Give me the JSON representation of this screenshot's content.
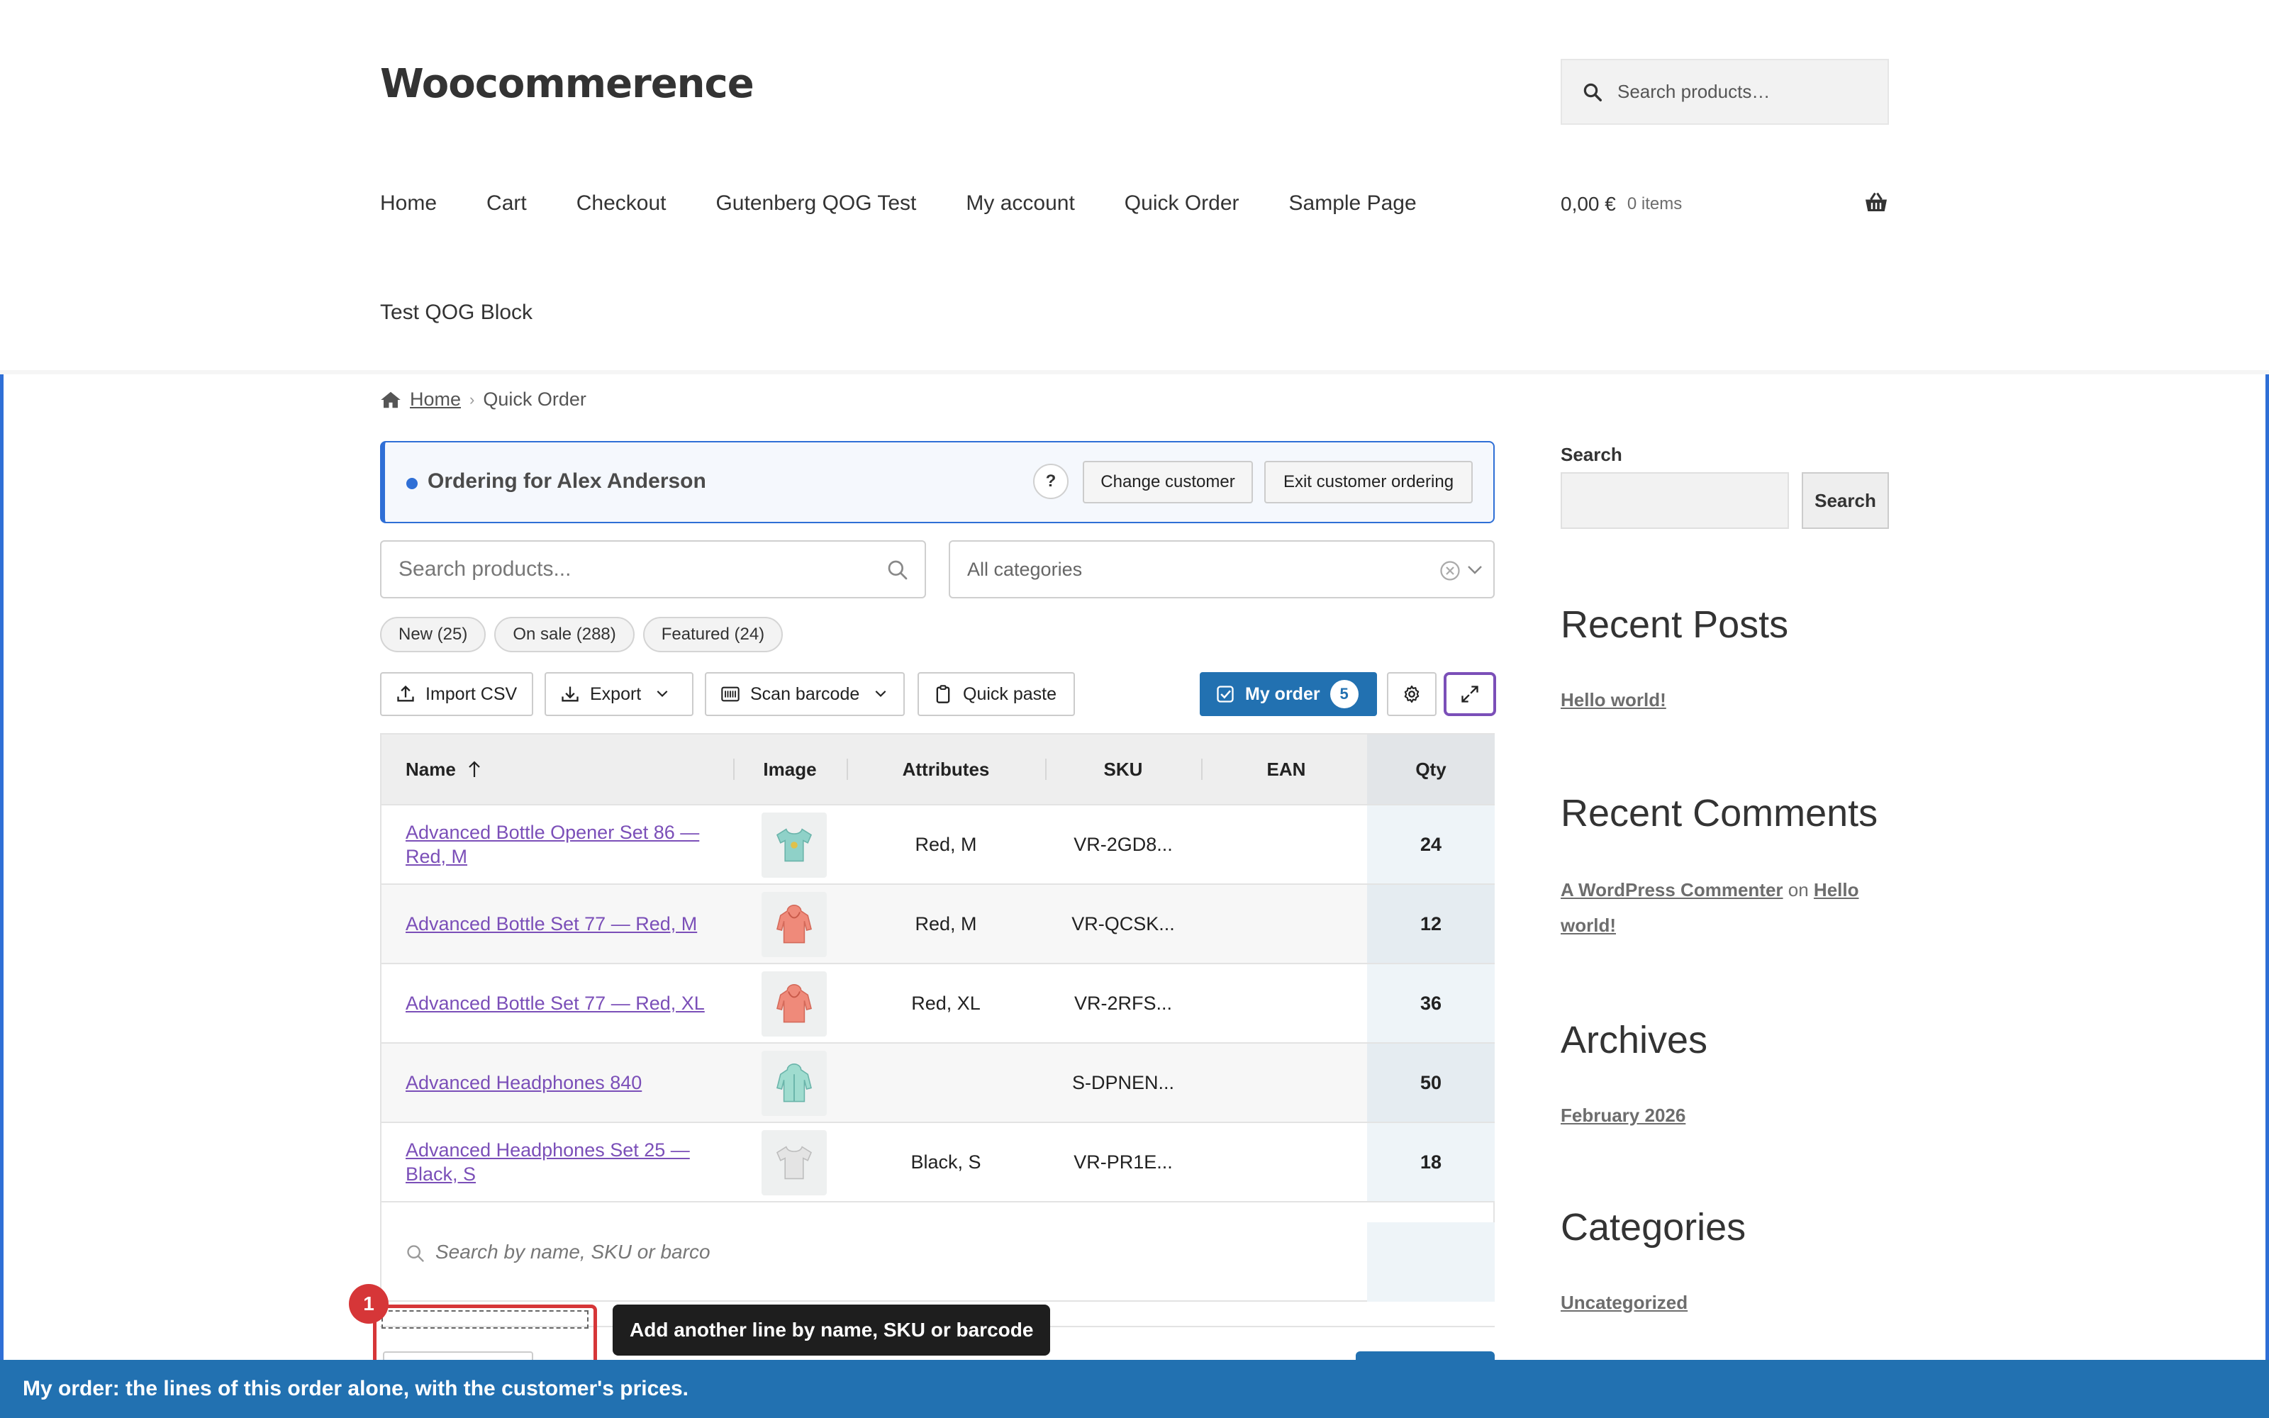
{
  "site": {
    "title": "Woocommerence"
  },
  "header_search": {
    "placeholder": "Search products…"
  },
  "nav": {
    "items": [
      "Home",
      "Cart",
      "Checkout",
      "Gutenberg QOG Test",
      "My account",
      "Quick Order",
      "Sample Page"
    ],
    "row2": "Test QOG Block"
  },
  "cart": {
    "amount": "0,00 €",
    "items": "0 items"
  },
  "breadcrumb": {
    "home": "Home",
    "current": "Quick Order"
  },
  "banner": {
    "title": "Ordering for Alex Anderson",
    "help": "?",
    "change_button": "Change customer",
    "exit_button": "Exit customer ordering"
  },
  "search": {
    "placeholder": "Search products..."
  },
  "category_select": {
    "value": "All categories"
  },
  "filter_pills": [
    "New (25)",
    "On sale (288)",
    "Featured (24)"
  ],
  "toolbar": {
    "import": "Import CSV",
    "export": "Export",
    "scan": "Scan barcode",
    "paste": "Quick paste",
    "my_order": "My order",
    "my_order_count": "5"
  },
  "table": {
    "headers": {
      "name": "Name",
      "image": "Image",
      "attributes": "Attributes",
      "sku": "SKU",
      "ean": "EAN",
      "qty": "Qty"
    },
    "rows": [
      {
        "name": "Advanced Bottle Opener Set 86 — Red, M",
        "image": "tshirt-teal-icon",
        "attributes": "Red, M",
        "sku": "VR-2GD8...",
        "ean": "",
        "qty": "24"
      },
      {
        "name": "Advanced Bottle Set 77 — Red, M",
        "image": "hoodie-red-icon",
        "attributes": "Red, M",
        "sku": "VR-QCSK...",
        "ean": "",
        "qty": "12"
      },
      {
        "name": "Advanced Bottle Set 77 — Red, XL",
        "image": "hoodie-red-icon",
        "attributes": "Red, XL",
        "sku": "VR-2RFS...",
        "ean": "",
        "qty": "36"
      },
      {
        "name": "Advanced Headphones 840",
        "image": "hoodie-teal-icon",
        "attributes": "",
        "sku": "S-DPNEN...",
        "ean": "",
        "qty": "50"
      },
      {
        "name": "Advanced Headphones Set 25 — Black, S",
        "image": "tshirt-grey-icon",
        "attributes": "Black, S",
        "sku": "VR-PR1E...",
        "ean": "",
        "qty": "18"
      }
    ],
    "add_line_placeholder": "Search by name, SKU or barco"
  },
  "tour": {
    "step": "1",
    "tooltip": "Add another line by name, SKU or barcode",
    "bottom_bar": "My order: the lines of this order alone, with the customer's prices."
  },
  "sidebar": {
    "search_label": "Search",
    "search_button": "Search",
    "recent_posts_heading": "Recent Posts",
    "recent_posts": [
      "Hello world!"
    ],
    "recent_comments_heading": "Recent Comments",
    "comment": {
      "author": "A WordPress Commenter",
      "on": "on",
      "post": "Hello world!"
    },
    "archives_heading": "Archives",
    "archives": [
      "February 2026"
    ],
    "categories_heading": "Categories",
    "categories": [
      "Uncategorized"
    ]
  },
  "colors": {
    "accent_blue": "#2271b1",
    "frame_blue": "#2f6fd6",
    "link_purple": "#7b4fb8",
    "tour_red": "#d63638"
  }
}
